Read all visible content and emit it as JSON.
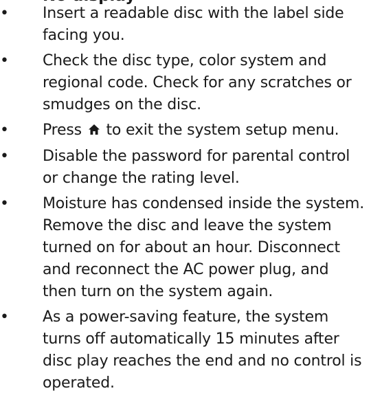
{
  "heading_partial": "No display",
  "bullets": [
    {
      "text": "Insert a readable disc with the label side facing you."
    },
    {
      "text": "Check the disc type, color system and regional code. Check for any scratches or smudges on the disc."
    },
    {
      "text_before": "Press",
      "icon": "home-icon",
      "text_after": "to exit the system setup menu."
    },
    {
      "text": "Disable the password for parental control or change the rating level."
    },
    {
      "text": "Moisture has condensed inside the system. Remove the disc and leave the system turned on for about an hour. Disconnect and reconnect the AC power plug, and then turn on the system again."
    },
    {
      "text": "As a power-saving feature, the system turns off automatically 15 minutes after disc play reaches the end and no control is operated."
    }
  ],
  "bullet_char": "•"
}
